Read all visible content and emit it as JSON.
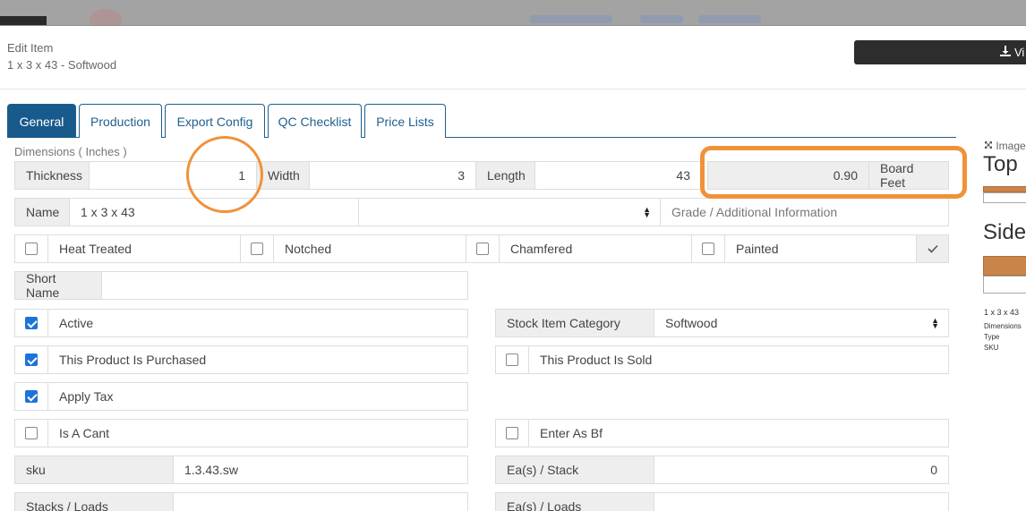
{
  "header": {
    "edit_label": "Edit Item",
    "item_subtitle": "1 x 3 x 43 - Softwood",
    "view_button_label": "Vi"
  },
  "tabs": [
    {
      "label": "General",
      "active": true
    },
    {
      "label": "Production"
    },
    {
      "label": "Export Config"
    },
    {
      "label": "QC Checklist"
    },
    {
      "label": "Price Lists"
    }
  ],
  "dimensions": {
    "heading": "Dimensions ( Inches )",
    "thickness_label": "Thickness",
    "thickness_value": "1",
    "width_label": "Width",
    "width_value": "3",
    "length_label": "Length",
    "length_value": "43",
    "board_feet_value": "0.90",
    "board_feet_label": "Board Feet"
  },
  "name_row": {
    "name_label": "Name",
    "name_value": "1 x 3 x 43",
    "grade_select_value": "",
    "grade_placeholder": "Grade / Additional Information"
  },
  "features": [
    {
      "label": "Heat Treated",
      "checked": false
    },
    {
      "label": "Notched",
      "checked": false
    },
    {
      "label": "Chamfered",
      "checked": false
    },
    {
      "label": "Painted",
      "checked": false
    }
  ],
  "short_name_label": "Short Name",
  "short_name_value": "",
  "checkboxes": {
    "active": {
      "label": "Active",
      "checked": true
    },
    "purchased": {
      "label": "This Product Is Purchased",
      "checked": true
    },
    "apply_tax": {
      "label": "Apply Tax",
      "checked": true
    },
    "is_cant": {
      "label": "Is A Cant",
      "checked": false
    },
    "is_sold": {
      "label": "This Product Is Sold",
      "checked": false
    },
    "enter_as_bf": {
      "label": "Enter As Bf",
      "checked": false
    }
  },
  "stock_category": {
    "label": "Stock Item Category",
    "value": "Softwood"
  },
  "sku": {
    "label": "sku",
    "value": "1.3.43.sw"
  },
  "ea_stack": {
    "label": "Ea(s) / Stack",
    "value": "0"
  },
  "stacks_loads": {
    "label": "Stacks / Loads",
    "value": ""
  },
  "ea_loads": {
    "label": "Ea(s) / Loads",
    "value": ""
  },
  "side_panel": {
    "images_label": "Image",
    "top_label": "Top",
    "side_label": "Side",
    "item_name": "1 x 3 x 43",
    "dimensions_label": "Dimensions",
    "type_label": "Type",
    "sku_label": "SKU"
  },
  "colors": {
    "tab_active": "#185a8c",
    "checkbox_checked": "#1d73d7",
    "highlight": "#f0923a",
    "wood": "#c9844a"
  }
}
